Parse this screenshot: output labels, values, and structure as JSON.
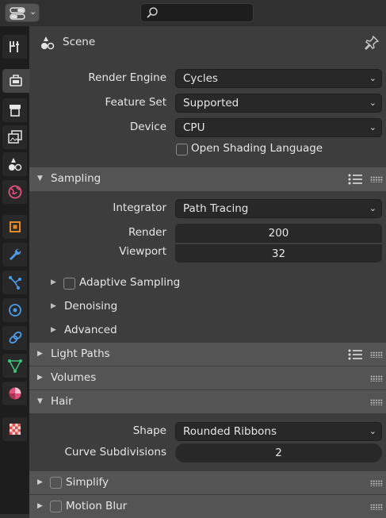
{
  "header": {
    "editor_type_icon": "properties-editor-icon",
    "search_placeholder": ""
  },
  "tabs": [
    {
      "name": "tool",
      "icon": "tool-icon"
    },
    {
      "name": "render",
      "icon": "render-icon",
      "active": true
    },
    {
      "name": "output",
      "icon": "output-icon"
    },
    {
      "name": "view-layer",
      "icon": "view-layer-icon"
    },
    {
      "name": "scene",
      "icon": "scene-icon"
    },
    {
      "name": "world",
      "icon": "world-icon"
    },
    {
      "name": "object",
      "icon": "object-icon"
    },
    {
      "name": "modifiers",
      "icon": "wrench-icon"
    },
    {
      "name": "particles",
      "icon": "particles-icon"
    },
    {
      "name": "physics",
      "icon": "physics-icon"
    },
    {
      "name": "constraints",
      "icon": "constraints-icon"
    },
    {
      "name": "data",
      "icon": "mesh-data-icon"
    },
    {
      "name": "material",
      "icon": "material-icon"
    },
    {
      "name": "texture",
      "icon": "texture-icon"
    }
  ],
  "context": {
    "title": "Scene"
  },
  "render_settings": {
    "render_engine_label": "Render Engine",
    "render_engine_value": "Cycles",
    "feature_set_label": "Feature Set",
    "feature_set_value": "Supported",
    "device_label": "Device",
    "device_value": "CPU",
    "osl_label": "Open Shading Language",
    "osl_checked": false
  },
  "sampling": {
    "title": "Sampling",
    "integrator_label": "Integrator",
    "integrator_value": "Path Tracing",
    "render_label": "Render",
    "render_value": "200",
    "viewport_label": "Viewport",
    "viewport_value": "32",
    "adaptive_label": "Adaptive Sampling",
    "denoising_label": "Denoising",
    "advanced_label": "Advanced"
  },
  "panels": {
    "light_paths": "Light Paths",
    "volumes": "Volumes",
    "hair": "Hair",
    "simplify": "Simplify",
    "motion_blur": "Motion Blur"
  },
  "hair": {
    "shape_label": "Shape",
    "shape_value": "Rounded Ribbons",
    "curve_subdiv_label": "Curve Subdivisions",
    "curve_subdiv_value": "2"
  },
  "colors": {
    "accent_orange": "#e08a2c",
    "panel_header": "#545454",
    "field": "#282828"
  }
}
